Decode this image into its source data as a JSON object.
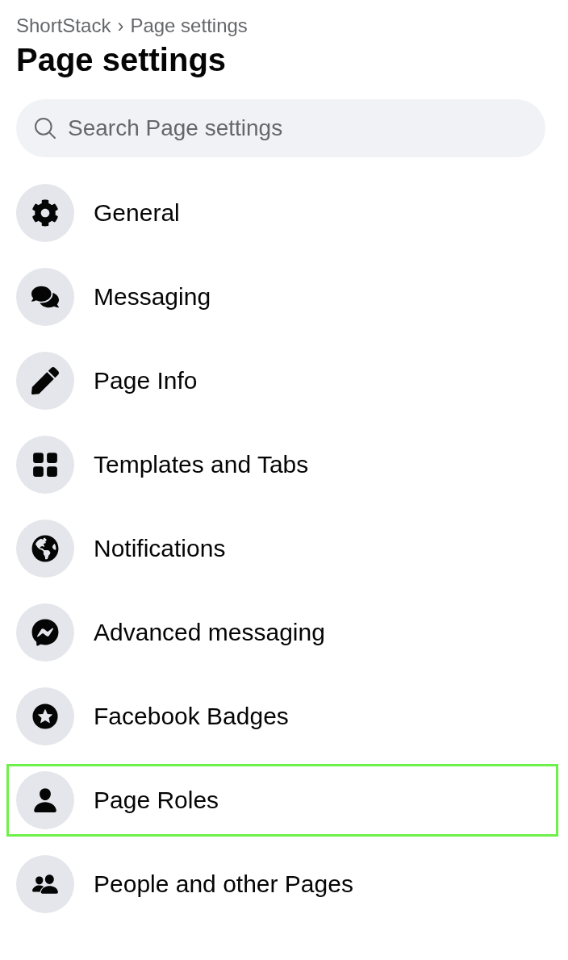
{
  "breadcrumb": {
    "items": [
      "ShortStack",
      "Page settings"
    ],
    "separator": "›"
  },
  "title": "Page settings",
  "search": {
    "placeholder": "Search Page settings"
  },
  "menu": [
    {
      "label": "General",
      "selected": false
    },
    {
      "label": "Messaging",
      "selected": false
    },
    {
      "label": "Page Info",
      "selected": false
    },
    {
      "label": "Templates and Tabs",
      "selected": false
    },
    {
      "label": "Notifications",
      "selected": false
    },
    {
      "label": "Advanced messaging",
      "selected": false
    },
    {
      "label": "Facebook Badges",
      "selected": false
    },
    {
      "label": "Page Roles",
      "selected": true
    },
    {
      "label": "People and other Pages",
      "selected": false
    }
  ]
}
